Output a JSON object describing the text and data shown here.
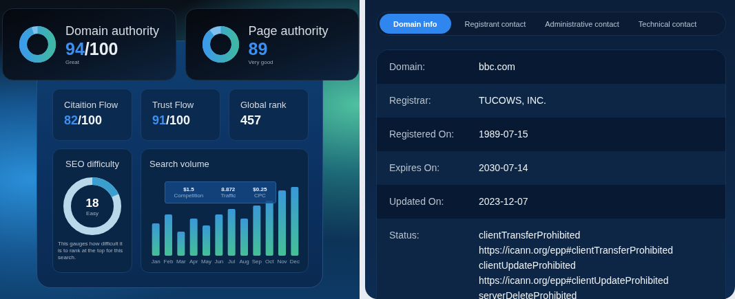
{
  "authority_cards": [
    {
      "title": "Domain authority",
      "score": "94",
      "suffix": "/100",
      "rating": "Great",
      "level": 0.94
    },
    {
      "title": "Page authority",
      "score": "89",
      "rating": "Very good",
      "level": 0.89
    }
  ],
  "stat_cards": [
    {
      "title": "Citaition Flow",
      "score": "82",
      "suffix": "/100"
    },
    {
      "title": "Trust Flow",
      "score": "91",
      "suffix": "/100"
    },
    {
      "title": "Global rank",
      "value": "457"
    }
  ],
  "seo_difficulty": {
    "title": "SEO difficulty",
    "score": "18",
    "rating": "Easy",
    "level": 0.18,
    "description": "This gauges how difficult it is to rank at the top for this search."
  },
  "search_volume": {
    "title": "Search volume",
    "tooltip": [
      {
        "value": "$1.5",
        "label": "Competition"
      },
      {
        "value": "8.872",
        "label": "Traffic"
      },
      {
        "value": "$0.25",
        "label": "CPC"
      }
    ],
    "months": [
      "Jan",
      "Feb",
      "Mar",
      "Apr",
      "May",
      "Jun",
      "Jul",
      "Aug",
      "Sep",
      "Oct",
      "Nov",
      "Dec"
    ]
  },
  "tabs": [
    {
      "label": "Domain info",
      "selected": true
    },
    {
      "label": "Registrant contact",
      "selected": false
    },
    {
      "label": "Administrative contact",
      "selected": false
    },
    {
      "label": "Technical contact",
      "selected": false
    }
  ],
  "domain_info": [
    {
      "label": "Domain:",
      "values": [
        "bbc.com"
      ]
    },
    {
      "label": "Registrar:",
      "values": [
        "TUCOWS, INC."
      ]
    },
    {
      "label": "Registered On:",
      "values": [
        "1989-07-15"
      ]
    },
    {
      "label": "Expires On:",
      "values": [
        "2030-07-14"
      ]
    },
    {
      "label": "Updated On:",
      "values": [
        "2023-12-07"
      ]
    },
    {
      "label": "Status:",
      "values": [
        "clientTransferProhibited",
        "https://icann.org/epp#clientTransferProhibited",
        "clientUpdateProhibited",
        "https://icann.org/epp#clientUpdateProhibited",
        "serverDeleteProhibited"
      ]
    }
  ]
}
